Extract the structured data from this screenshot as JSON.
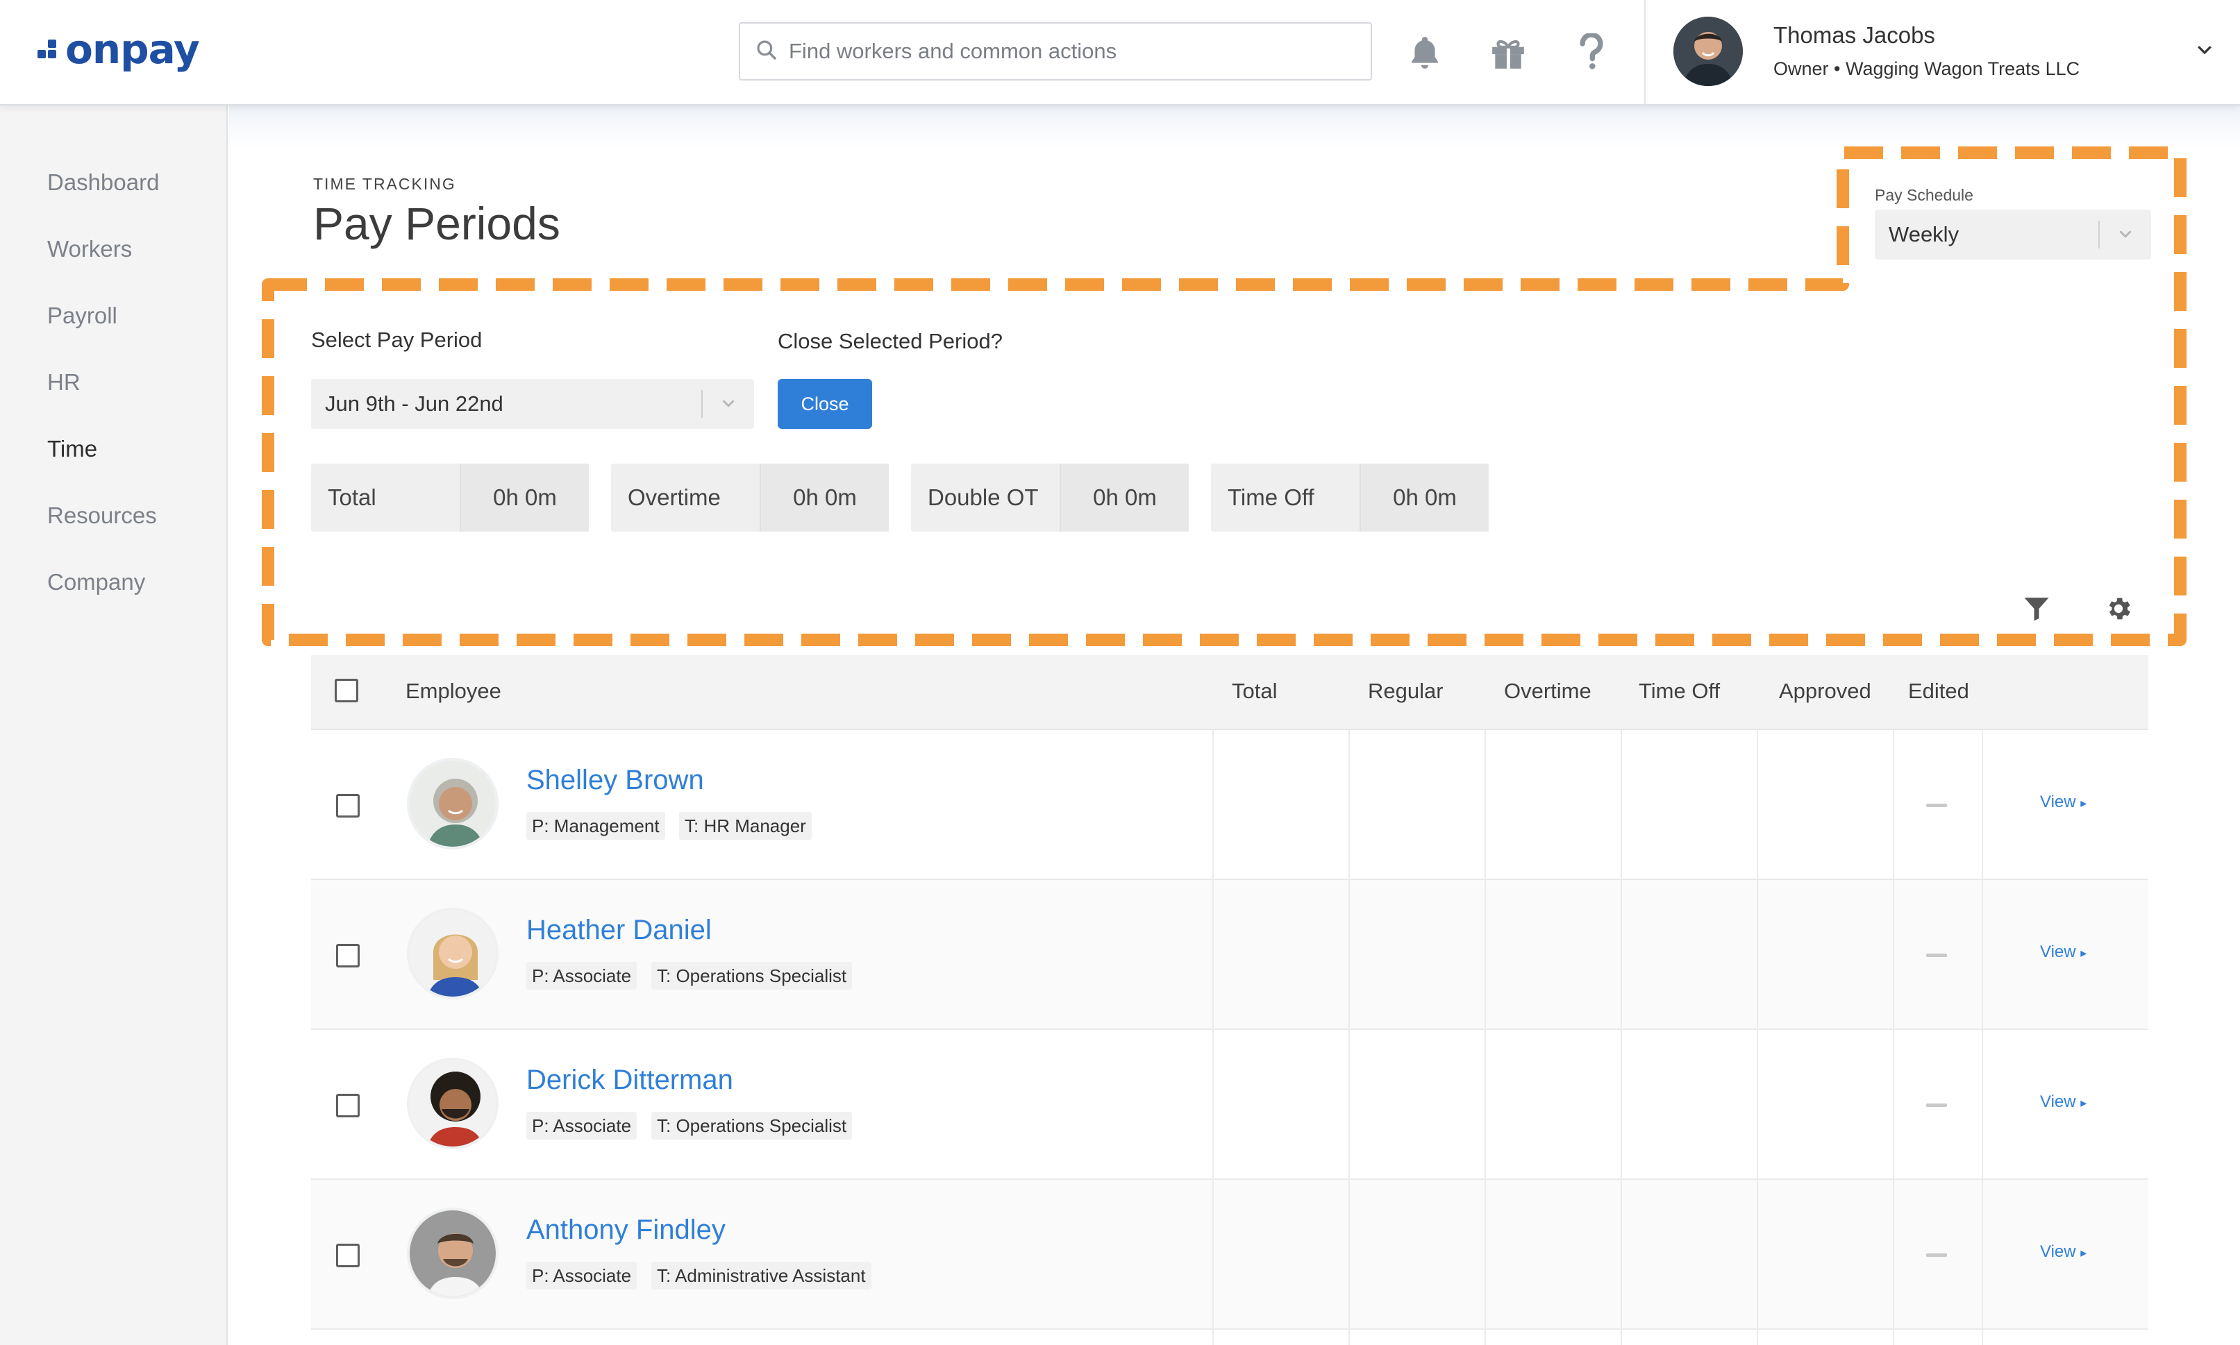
{
  "brand": {
    "name": "onpay",
    "accent": "#1f4fa3",
    "link": "#2f7fd8",
    "highlight": "#f39a3b"
  },
  "header": {
    "search_placeholder": "Find workers and common actions",
    "icons": [
      "bell-icon",
      "gift-icon",
      "help-icon"
    ],
    "user": {
      "name": "Thomas Jacobs",
      "role": "Owner • Wagging Wagon Treats LLC"
    }
  },
  "sidebar": {
    "items": [
      {
        "label": "Dashboard"
      },
      {
        "label": "Workers"
      },
      {
        "label": "Payroll"
      },
      {
        "label": "HR"
      },
      {
        "label": "Time",
        "active": true
      },
      {
        "label": "Resources"
      },
      {
        "label": "Company"
      }
    ]
  },
  "page": {
    "eyebrow": "TIME TRACKING",
    "title": "Pay Periods"
  },
  "pay_schedule": {
    "label": "Pay Schedule",
    "value": "Weekly"
  },
  "period": {
    "label": "Select Pay Period",
    "value": "Jun 9th - Jun 22nd",
    "close_label": "Close Selected Period?",
    "close_button": "Close"
  },
  "stats": [
    {
      "name": "Total",
      "value": "0h 0m"
    },
    {
      "name": "Overtime",
      "value": "0h 0m"
    },
    {
      "name": "Double OT",
      "value": "0h 0m"
    },
    {
      "name": "Time Off",
      "value": "0h 0m"
    }
  ],
  "table": {
    "columns": [
      "Employee",
      "Total",
      "Regular",
      "Overtime",
      "Time Off",
      "Approved",
      "Edited"
    ],
    "rows": [
      {
        "name": "Shelley Brown",
        "position": "P: Management",
        "title": "T: HR Manager",
        "view": "View"
      },
      {
        "name": "Heather Daniel",
        "position": "P: Associate",
        "title": "T: Operations Specialist",
        "view": "View"
      },
      {
        "name": "Derick Ditterman",
        "position": "P: Associate",
        "title": "T: Operations Specialist",
        "view": "View"
      },
      {
        "name": "Anthony Findley",
        "position": "P: Associate",
        "title": "T: Administrative Assistant",
        "view": "View"
      }
    ]
  }
}
